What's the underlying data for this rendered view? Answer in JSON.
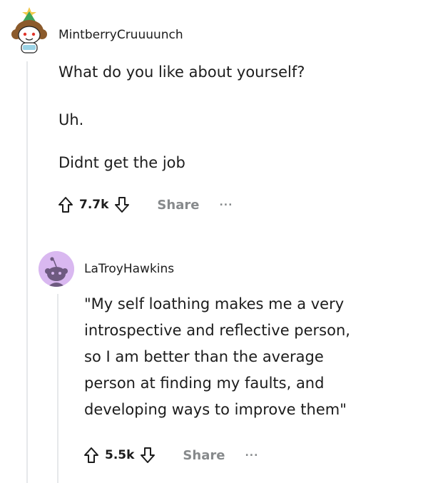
{
  "comment1": {
    "username": "MintberryCruuuunch",
    "paragraphs": [
      "What do you like about yourself?",
      "Uh.",
      "Didnt get the job"
    ],
    "upvotes": "7.7k",
    "share_label": "Share",
    "more_label": "..."
  },
  "comment2": {
    "username": "LaTroyHawkins",
    "lines": [
      "\"My self loathing makes me a very",
      "introspective and reflective person,",
      "so I am better than the average",
      "person at finding my faults, and",
      "developing ways to improve them\""
    ],
    "upvotes": "5.5k",
    "share_label": "Share",
    "more_label": "..."
  },
  "icons": {
    "upvote": "arrow-up-outline-icon",
    "downvote": "arrow-down-outline-icon",
    "more": "ellipsis-icon"
  },
  "colors": {
    "text": "#1c1c1c",
    "muted": "#878a8c",
    "thread_line": "#e6e8ea",
    "avatar2_bg": "#d9b8f0"
  }
}
